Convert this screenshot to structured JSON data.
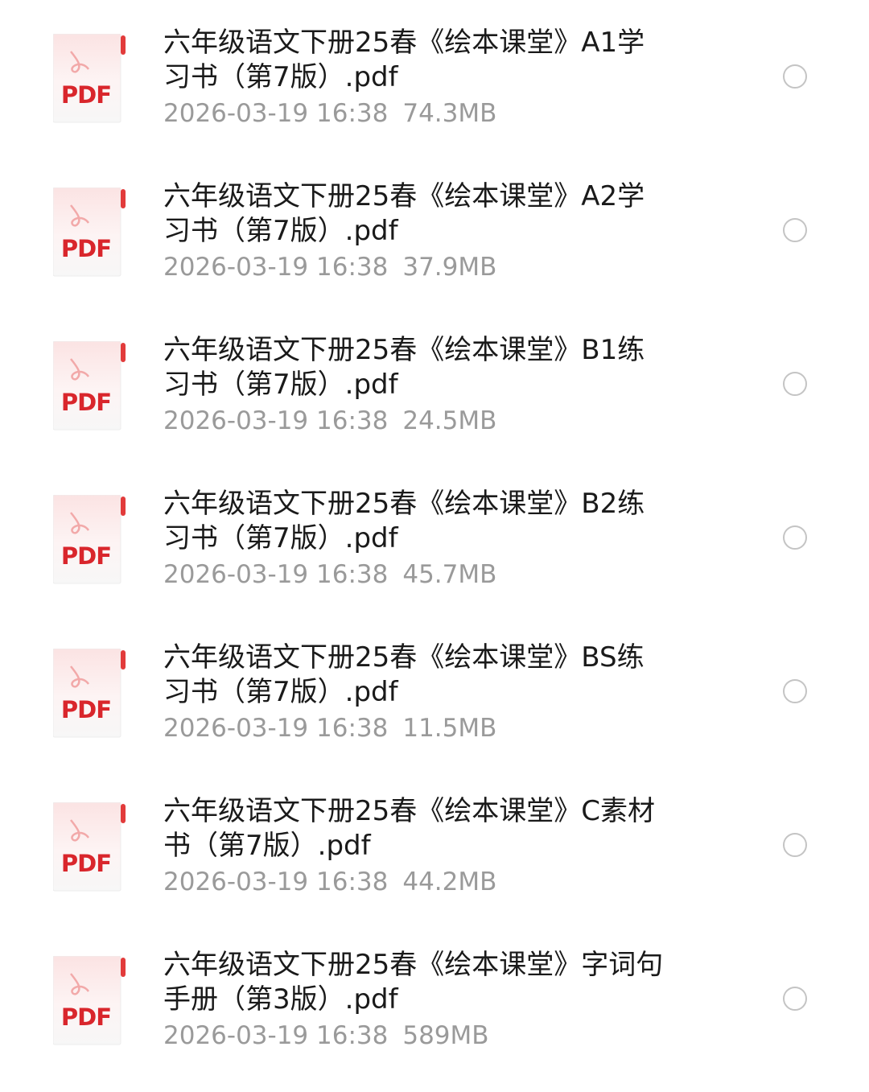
{
  "icon": {
    "name": "pdf-file-icon",
    "label": "PDF",
    "accent_color": "#d9262c"
  },
  "files": [
    {
      "name": "六年级语文下册25春《绘本课堂》A1学\n习书（第7版）.pdf",
      "date": "2026-03-19 16:38",
      "size": "74.3MB"
    },
    {
      "name": "六年级语文下册25春《绘本课堂》A2学\n习书（第7版）.pdf",
      "date": "2026-03-19 16:38",
      "size": "37.9MB"
    },
    {
      "name": "六年级语文下册25春《绘本课堂》B1练\n习书（第7版）.pdf",
      "date": "2026-03-19 16:38",
      "size": "24.5MB"
    },
    {
      "name": "六年级语文下册25春《绘本课堂》B2练\n习书（第7版）.pdf",
      "date": "2026-03-19 16:38",
      "size": "45.7MB"
    },
    {
      "name": "六年级语文下册25春《绘本课堂》BS练\n习书（第7版）.pdf",
      "date": "2026-03-19 16:38",
      "size": "11.5MB"
    },
    {
      "name": "六年级语文下册25春《绘本课堂》C素材\n书（第7版）.pdf",
      "date": "2026-03-19 16:38",
      "size": "44.2MB"
    },
    {
      "name": "六年级语文下册25春《绘本课堂》字词句\n手册（第3版）.pdf",
      "date": "2026-03-19 16:38",
      "size": "589MB"
    }
  ]
}
